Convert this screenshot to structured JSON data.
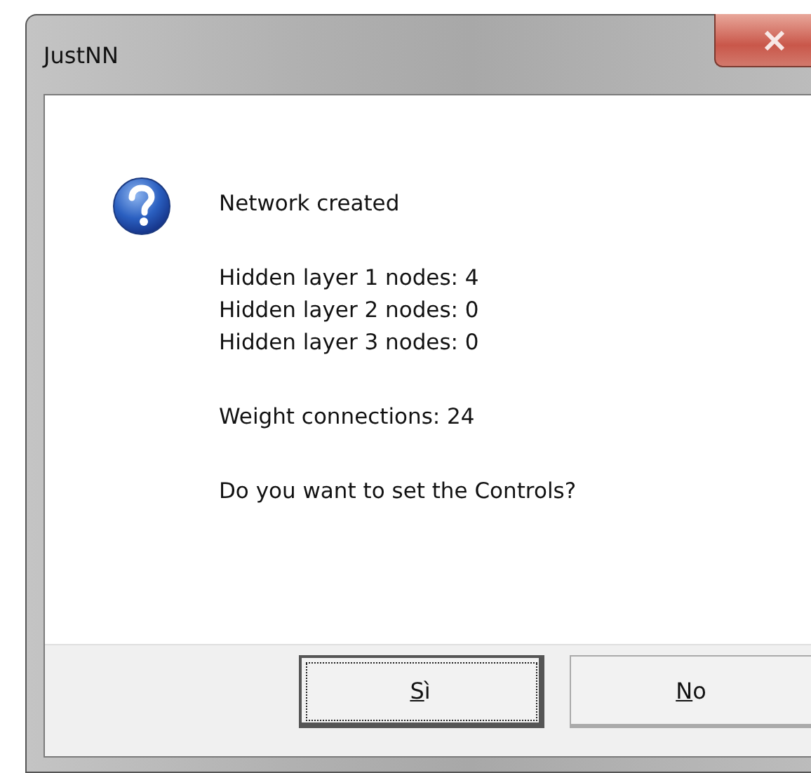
{
  "window": {
    "title": "JustNN"
  },
  "message": {
    "heading": "Network created",
    "lines": [
      "Hidden layer 1 nodes: 4",
      "Hidden layer 2 nodes: 0",
      "Hidden layer 3 nodes: 0"
    ],
    "summary": "Weight connections: 24",
    "question": "Do you want to set the Controls?"
  },
  "buttons": [
    {
      "label": "Sì",
      "focused": true
    },
    {
      "label": "No",
      "focused": false
    }
  ]
}
